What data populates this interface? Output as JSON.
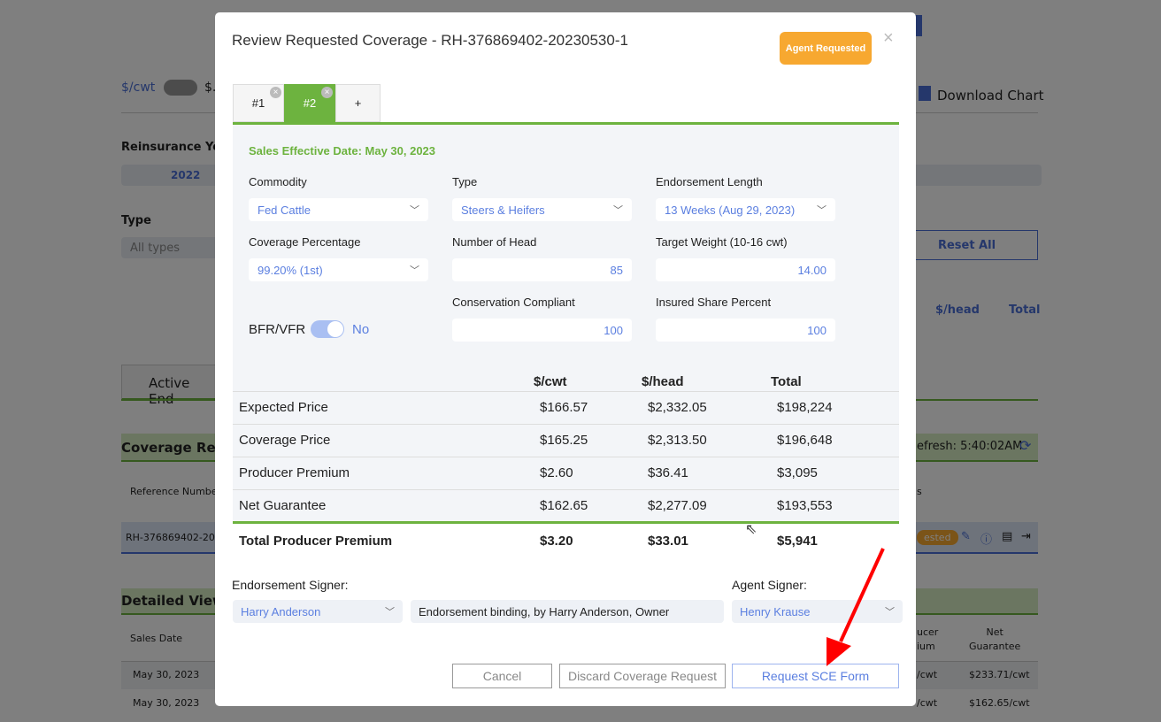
{
  "background": {
    "unit_left": "$/cwt",
    "unit_right": "$.",
    "download_chart": "Download Chart",
    "reinsurance_year_label": "Reinsurance Yea",
    "reinsurance_year_value": "2022",
    "type_label": "Type",
    "type_value": "All types",
    "reset_all": "Reset All",
    "radio_head": "$/head",
    "radio_total": "Total",
    "active_tab": "Active End",
    "coverage_requests": "Coverage Requ",
    "refresh": "efresh: 5:40:02AM",
    "ref_number_header": "Reference Numbe",
    "ref_value": "RH-376869402-202",
    "status_badge": "ested",
    "col_s": "s",
    "detailed_view": "Detailed View",
    "sales_date_header": "Sales Date",
    "producer_premium_header": "ucer\nium",
    "net_guarantee_header": "Net\nGuarantee",
    "rows": [
      {
        "date": "May 30, 2023",
        "pp": "/cwt",
        "ng": "$233.71/cwt"
      },
      {
        "date": "May 30, 2023",
        "pp": "/cwt",
        "ng": "$162.65/cwt"
      }
    ]
  },
  "modal": {
    "title": "Review Requested Coverage - RH-376869402-20230530-1",
    "badge": "Agent Requested",
    "close": "×",
    "tabs": [
      {
        "label": "#1"
      },
      {
        "label": "#2"
      },
      {
        "label": "+"
      }
    ],
    "sales_effective_date": "Sales Effective Date: May 30, 2023",
    "fields": {
      "commodity": {
        "label": "Commodity",
        "value": "Fed Cattle"
      },
      "type": {
        "label": "Type",
        "value": "Steers & Heifers"
      },
      "endorsement_length": {
        "label": "Endorsement Length",
        "value": "13 Weeks (Aug 29, 2023)"
      },
      "coverage_percentage": {
        "label": "Coverage Percentage",
        "value": "99.20% (1st)"
      },
      "number_of_head": {
        "label": "Number of Head",
        "value": "85"
      },
      "target_weight": {
        "label": "Target Weight (10-16 cwt)",
        "value": "14.00"
      },
      "conservation_compliant": {
        "label": "Conservation Compliant",
        "value": "100"
      },
      "insured_share": {
        "label": "Insured Share Percent",
        "value": "100"
      },
      "bfr_vfr": {
        "label": "BFR/VFR",
        "value": "No"
      }
    },
    "table": {
      "headers": [
        "",
        "$/cwt",
        "$/head",
        "Total"
      ],
      "rows": [
        [
          "Expected Price",
          "$166.57",
          "$2,332.05",
          "$198,224"
        ],
        [
          "Coverage Price",
          "$165.25",
          "$2,313.50",
          "$196,648"
        ],
        [
          "Producer Premium",
          "$2.60",
          "$36.41",
          "$3,095"
        ],
        [
          "Net Guarantee",
          "$162.65",
          "$2,277.09",
          "$193,553"
        ]
      ],
      "total": [
        "Total Producer Premium",
        "$3.20",
        "$33.01",
        "$5,941"
      ]
    },
    "endorsement_signer_label": "Endorsement Signer:",
    "endorsement_signer": "Harry Anderson",
    "binding_text": "Endorsement binding, by Harry Anderson, Owner",
    "agent_signer_label": "Agent Signer:",
    "agent_signer": "Henry Krause",
    "buttons": {
      "cancel": "Cancel",
      "discard": "Discard Coverage Request",
      "request": "Request SCE Form"
    }
  },
  "colors": {
    "accent_green": "#6db33f",
    "badge_orange": "#f7a830",
    "link_blue": "#5b7fe0",
    "arrow_red": "#ff0000"
  }
}
